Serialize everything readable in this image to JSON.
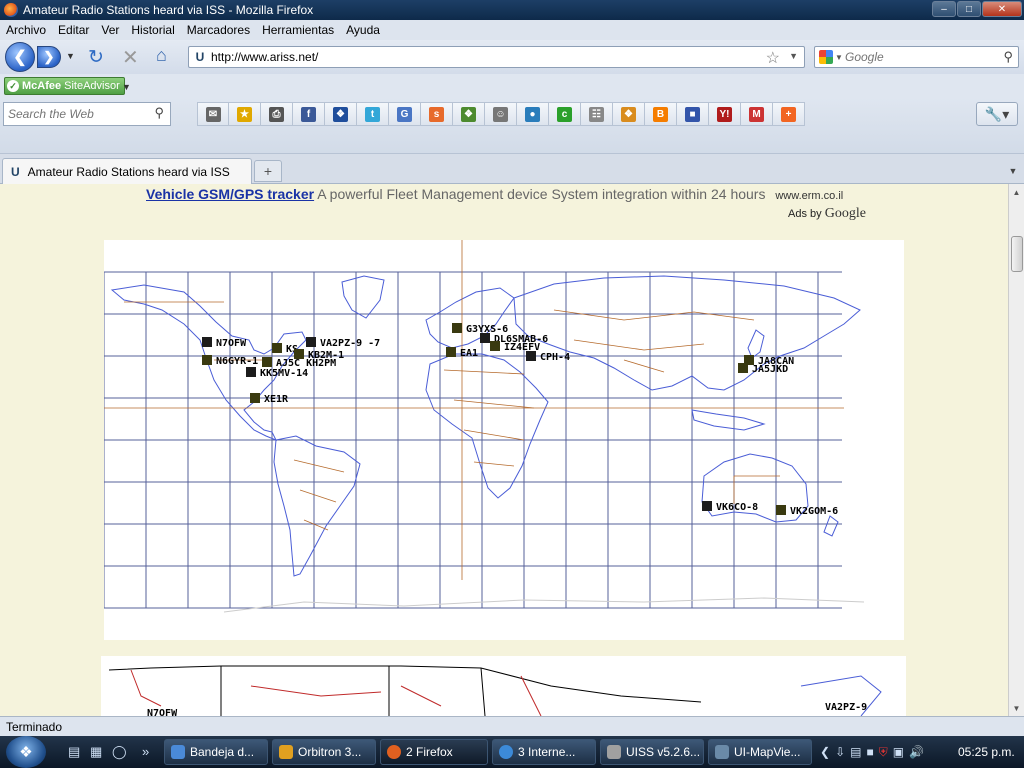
{
  "window": {
    "title": "Amateur Radio Stations heard via ISS - Mozilla Firefox",
    "buttons": [
      "–",
      "□",
      "✕"
    ]
  },
  "menu": [
    "Archivo",
    "Editar",
    "Ver",
    "Historial",
    "Marcadores",
    "Herramientas",
    "Ayuda"
  ],
  "nav": {
    "url": "http://www.ariss.net/",
    "search_placeholder": "Google"
  },
  "mcafee": {
    "brand": "McAfee",
    "label": "SiteAdvisor"
  },
  "toolbar2": {
    "search_placeholder": "Search the Web",
    "share_icons": [
      {
        "name": "mail-icon",
        "glyph": "✉",
        "color": "#666666"
      },
      {
        "name": "favorite-star-icon",
        "glyph": "★",
        "color": "#e0a800"
      },
      {
        "name": "print-icon",
        "glyph": "⎙",
        "color": "#555555"
      },
      {
        "name": "facebook-icon",
        "glyph": "f",
        "color": "#3b5998"
      },
      {
        "name": "myspace-icon",
        "glyph": "❖",
        "color": "#1f4e9c"
      },
      {
        "name": "twitter-icon",
        "glyph": "t",
        "color": "#33a7d8"
      },
      {
        "name": "google-icon",
        "glyph": "G",
        "color": "#4a76c4"
      },
      {
        "name": "stumbleupon-icon",
        "glyph": "s",
        "color": "#e76a2b"
      },
      {
        "name": "windows-live-icon",
        "glyph": "❖",
        "color": "#4d8b2f"
      },
      {
        "name": "reddit-icon",
        "glyph": "☺",
        "color": "#777777"
      },
      {
        "name": "digg-icon",
        "glyph": "●",
        "color": "#2a7dbb"
      },
      {
        "name": "orkut-icon",
        "glyph": "c",
        "color": "#2ba02b"
      },
      {
        "name": "share-icon",
        "glyph": "☷",
        "color": "#888888"
      },
      {
        "name": "live-icon",
        "glyph": "❖",
        "color": "#d98c1e"
      },
      {
        "name": "blogger-icon",
        "glyph": "B",
        "color": "#f57d00"
      },
      {
        "name": "delicious-icon",
        "glyph": "■",
        "color": "#3355aa"
      },
      {
        "name": "yahoo-icon",
        "glyph": "Y!",
        "color": "#b01c1c"
      },
      {
        "name": "gmail-icon",
        "glyph": "M",
        "color": "#cc3333"
      },
      {
        "name": "more-icon",
        "glyph": "+",
        "color": "#f26522"
      }
    ]
  },
  "tabs": [
    {
      "label": "Amateur Radio Stations heard via ISS"
    }
  ],
  "ad": {
    "link": "Vehicle GSM/GPS tracker",
    "text": "A powerful Fleet Management device System integration within 24 hours",
    "domain": "www.erm.co.il",
    "ads_by": "Ads by",
    "ads_brand": "Google"
  },
  "map": {
    "stations": [
      {
        "call": "N7OFW"
      },
      {
        "call": "N6GYR-1"
      },
      {
        "call": "KS"
      },
      {
        "call": "VA2PZ-9 -7"
      },
      {
        "call": "KB2M-1"
      },
      {
        "call": "AJ5C KH2PM"
      },
      {
        "call": "KK5MV-14"
      },
      {
        "call": "XE1R"
      },
      {
        "call": "G3YXS-6"
      },
      {
        "call": "DL6SMAB-6"
      },
      {
        "call": "IZ4EFV"
      },
      {
        "call": "EA1"
      },
      {
        "call": "CPH-4"
      },
      {
        "call": "JA8CAN"
      },
      {
        "call": "JA5JKD"
      },
      {
        "call": "VK6CO-8"
      },
      {
        "call": "VK2GOM-6"
      }
    ],
    "lower_stations": [
      {
        "call": "N7OFW"
      },
      {
        "call": "VA2PZ-9"
      }
    ]
  },
  "status": "Terminado",
  "taskbar": {
    "tasks": [
      "Bandeja d...",
      "Orbitron 3...",
      "2 Firefox",
      "3 Interne...",
      "UISS v5.2.6...",
      "UI-MapVie..."
    ],
    "clock": "05:25 p.m."
  }
}
